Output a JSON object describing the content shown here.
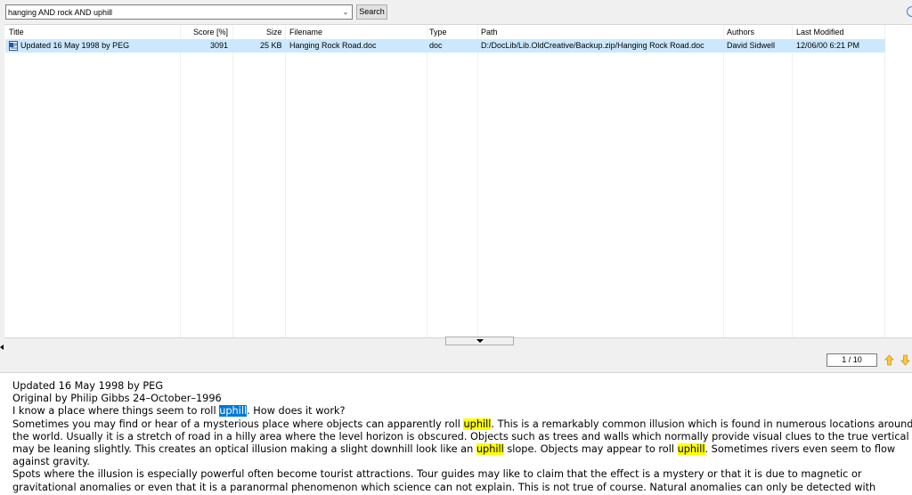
{
  "search": {
    "query": "hanging AND rock AND uphill",
    "button_label": "Search"
  },
  "results": {
    "columns": [
      "Title",
      "Score [%]",
      "Size",
      "Filename",
      "Type",
      "Path",
      "Authors",
      "Last Modified"
    ],
    "rows": [
      {
        "title": "Updated 16 May 1998 by PEG",
        "score": "3091",
        "size": "25 KB",
        "filename": "Hanging Rock Road.doc",
        "type": "doc",
        "path": "D:/DocLib/Lib.OldCreative/Backup.zip/Hanging Rock Road.doc",
        "authors": "David Sidwell",
        "modified": "12/06/00 6:21 PM"
      }
    ]
  },
  "pager": {
    "position": "1 / 10"
  },
  "preview": {
    "l1": "Updated 16 May 1998 by PEG",
    "l2": "Original by Philip Gibbs 24–October–1996",
    "l3a": "I know a place where things seem to roll ",
    "l3b": "uphill",
    "l3c": ". How does it work?",
    "l4a": "Sometimes you may find or hear of a mysterious place where objects can apparently roll ",
    "l4b": "uphill",
    "l4c": ". This is a remarkably common illusion which is found in numerous locations around",
    "l5": "the world. Usually it is a stretch of road in a hilly area where the level horizon is obscured. Objects such as trees and walls which normally provide visual clues to the true vertical",
    "l6a": "may be leaning slightly. This creates an optical illusion making a slight downhill look like an ",
    "l6b": "uphill",
    "l6c": " slope. Objects may appear to roll ",
    "l6d": "uphill",
    "l6e": ". Sometimes rivers even seem to flow",
    "l7": "against gravity.",
    "l8": "Spots where the illusion is especially powerful often become tourist attractions. Tour guides may like to claim that the effect is a mystery or that it is due to magnetic or",
    "l9": "gravitational anomalies or even that it is a paranormal phenomenon which science can not explain. This is not true of course. Natural anomalies can only be detected with"
  },
  "colors": {
    "selection_row": "#cce8ff",
    "highlight": "#ffff00",
    "selected_term": "#0078d7"
  }
}
